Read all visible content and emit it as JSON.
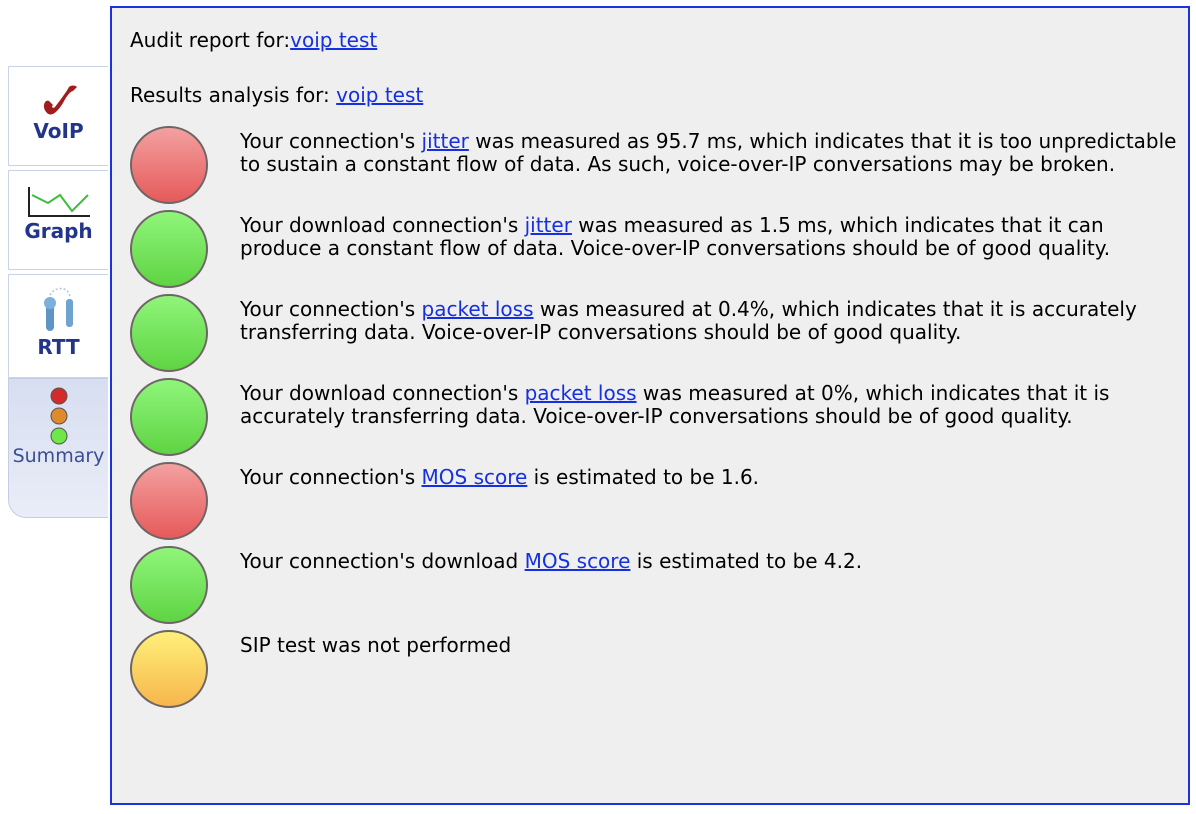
{
  "tabs": [
    {
      "label": "VoIP",
      "icon": "phone-icon",
      "active": false
    },
    {
      "label": "Graph",
      "icon": "line-graph-icon",
      "active": false
    },
    {
      "label": "RTT",
      "icon": "joystick-icon",
      "active": false
    },
    {
      "label": "Summary",
      "icon": "traffic-light-icon",
      "active": true
    }
  ],
  "header": {
    "audit_prefix": "Audit report for:",
    "audit_link": "voip test",
    "results_prefix": "Results analysis for: ",
    "results_link": "voip test"
  },
  "colors": {
    "red": "#e86060",
    "green": "#6ee050",
    "yellow": "#fbd060",
    "link": "#1530e0",
    "border": "#1a33dd"
  },
  "results": [
    {
      "status": "red",
      "pre": "Your connection's ",
      "link": "jitter",
      "post": " was measured as 95.7 ms, which indicates that it is too unpredictable to sustain a constant flow of data. As such, voice-over-IP conversations may be broken."
    },
    {
      "status": "green",
      "pre": "Your download connection's ",
      "link": "jitter",
      "post": " was measured as 1.5 ms, which indicates that it can produce a constant flow of data. Voice-over-IP conversations should be of good quality."
    },
    {
      "status": "green",
      "pre": "Your connection's ",
      "link": "packet loss",
      "post": " was measured at 0.4%, which indicates that it is accurately transferring data. Voice-over-IP conversations should be of good quality."
    },
    {
      "status": "green",
      "pre": "Your download connection's ",
      "link": "packet loss",
      "post": " was measured at 0%, which indicates that it is accurately transferring data. Voice-over-IP conversations should be of good quality."
    },
    {
      "status": "red",
      "pre": "Your connection's ",
      "link": "MOS score",
      "post": " is estimated to be 1.6."
    },
    {
      "status": "green",
      "pre": "Your connection's download ",
      "link": "MOS score",
      "post": " is estimated to be 4.2."
    },
    {
      "status": "yellow",
      "pre": "SIP test was not performed",
      "link": "",
      "post": ""
    }
  ]
}
